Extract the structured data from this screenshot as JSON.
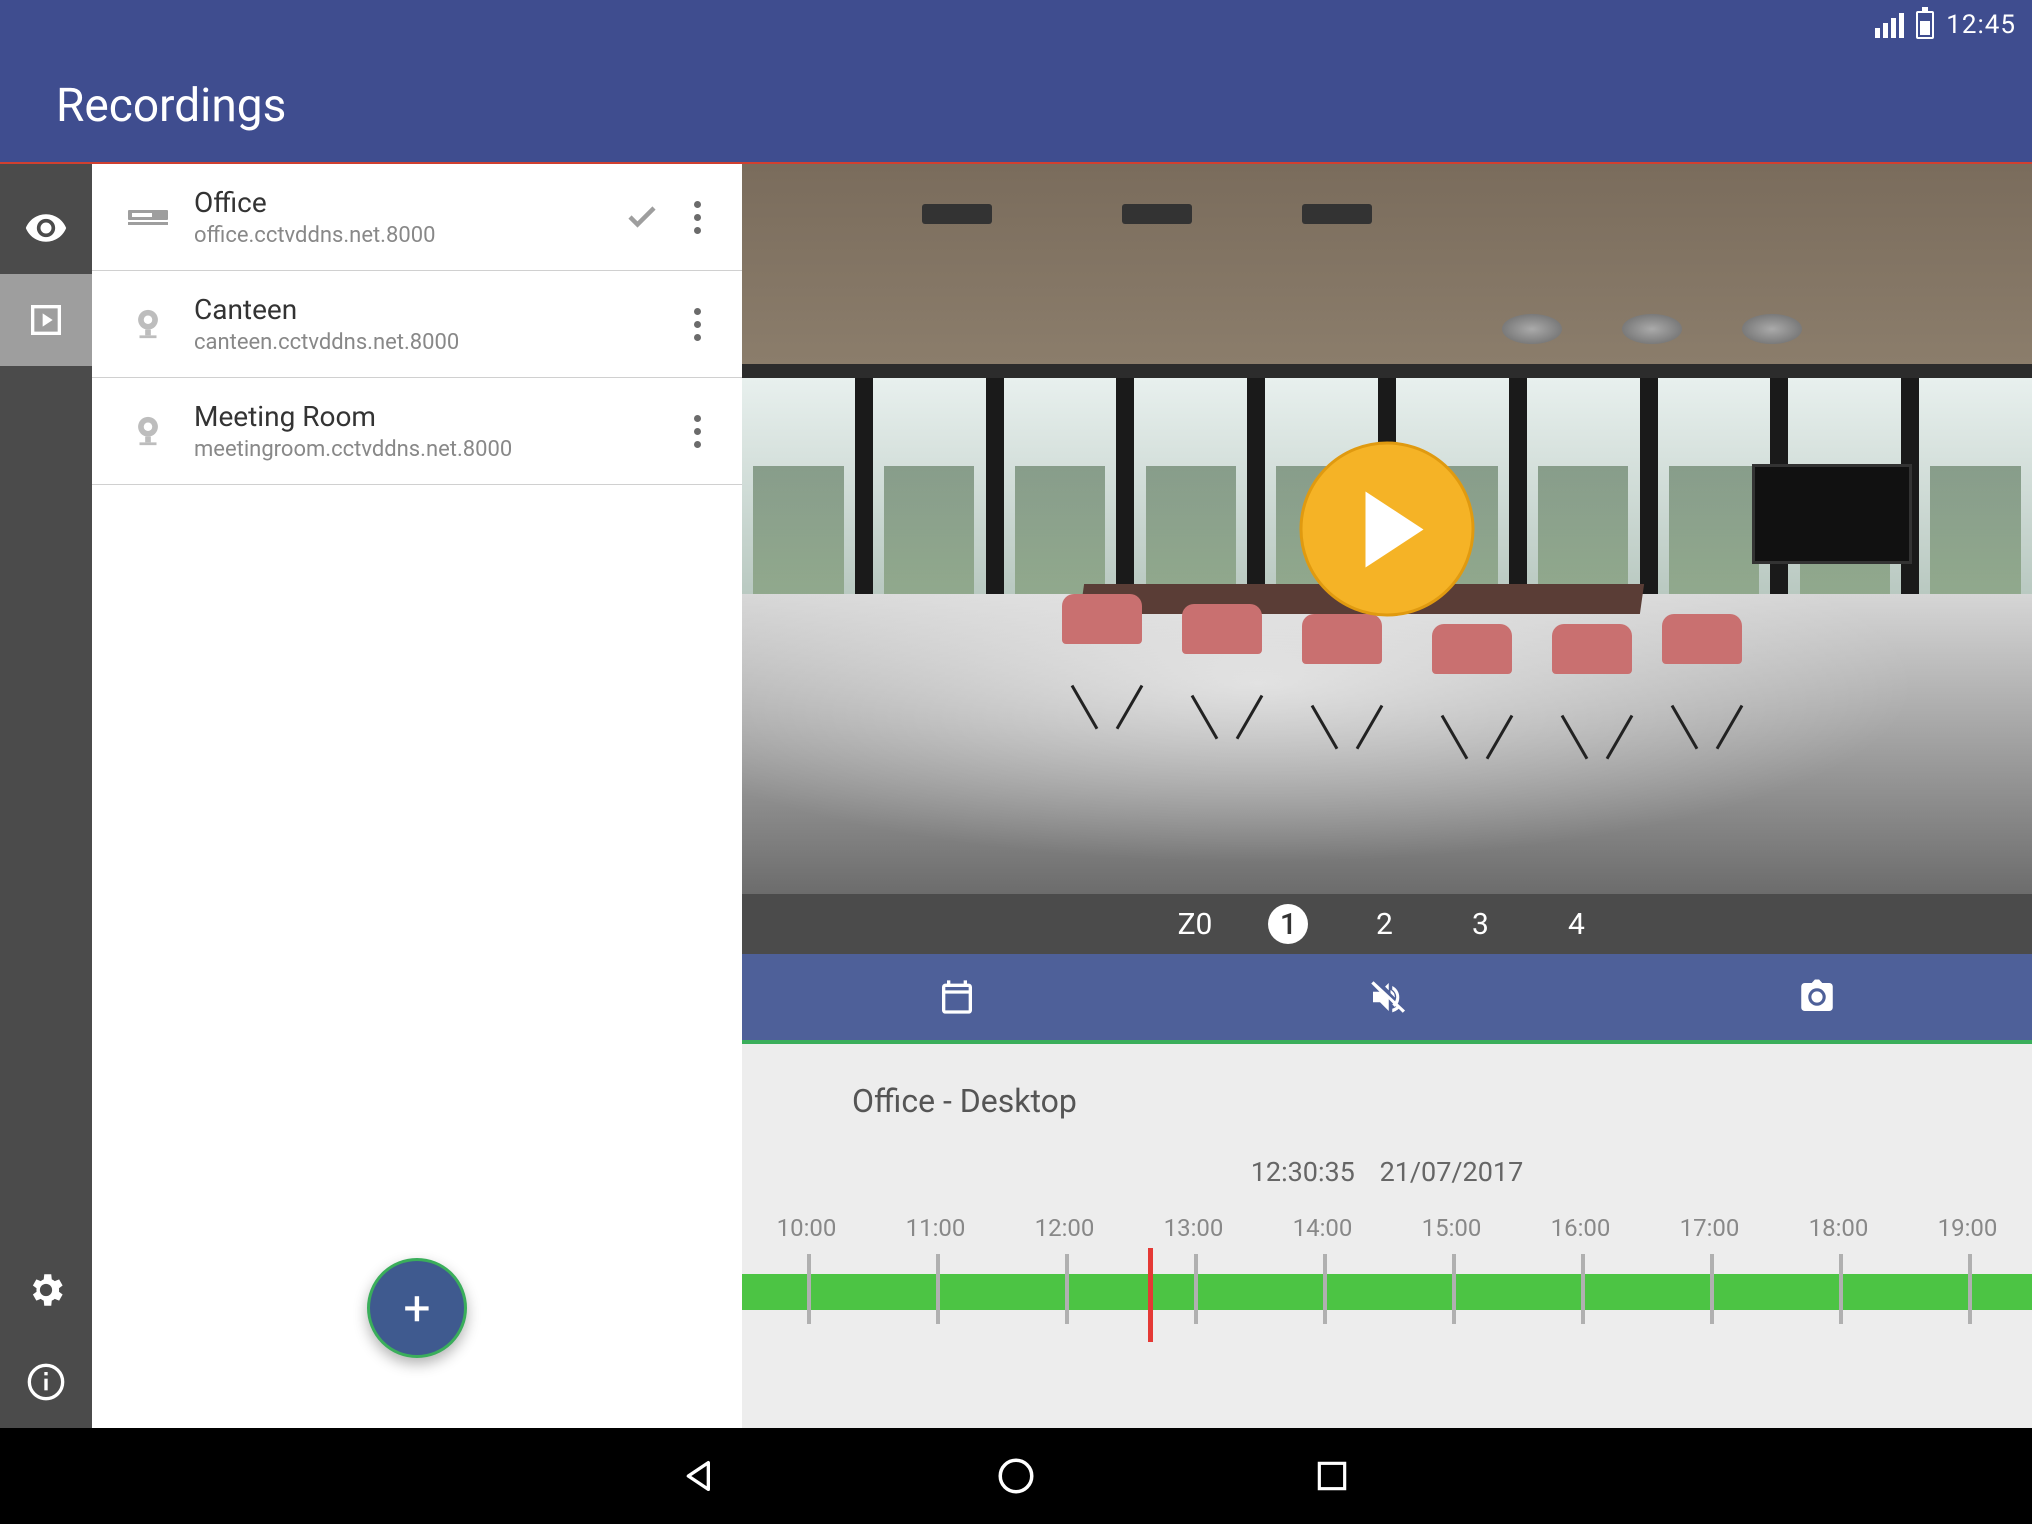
{
  "status": {
    "time": "12:45"
  },
  "header": {
    "title": "Recordings"
  },
  "rail": {
    "live": "live-view",
    "recordings": "recordings",
    "settings": "settings",
    "info": "info"
  },
  "fab": {
    "label": "+"
  },
  "devices": [
    {
      "name": "Office",
      "address": "office.cctvddns.net.8000",
      "type": "nvr",
      "selected": true
    },
    {
      "name": "Canteen",
      "address": "canteen.cctvddns.net.8000",
      "type": "camera",
      "selected": false
    },
    {
      "name": "Meeting Room",
      "address": "meetingroom.cctvddns.net.8000",
      "type": "camera",
      "selected": false
    }
  ],
  "channels": {
    "prefix": "Z0",
    "items": [
      "1",
      "2",
      "3",
      "4"
    ],
    "active": "1"
  },
  "tools": {
    "calendar": "calendar",
    "mute": "muted",
    "snapshot": "snapshot"
  },
  "timeline": {
    "title": "Office - Desktop",
    "time": "12:30:35",
    "date": "21/07/2017",
    "hours": [
      "10:00",
      "11:00",
      "12:00",
      "13:00",
      "14:00",
      "15:00",
      "16:00",
      "17:00",
      "18:00",
      "19:00"
    ],
    "cursor_percent": 31.5
  }
}
